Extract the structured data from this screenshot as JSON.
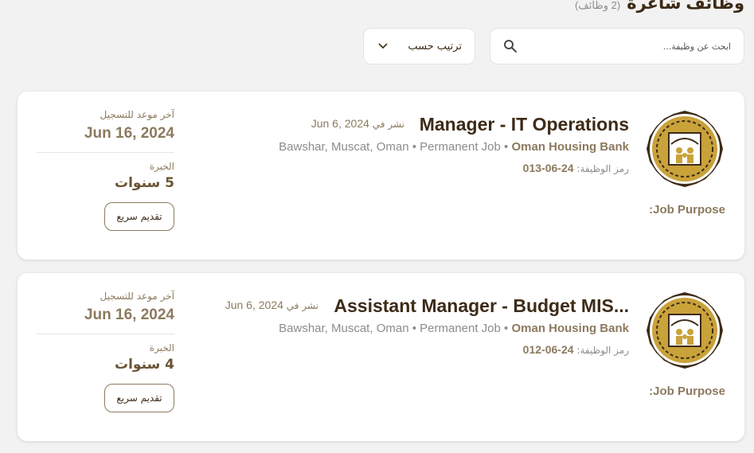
{
  "header": {
    "title": "وظائف شاغرة",
    "count_number": "2",
    "count_text": "(2 وظائف)"
  },
  "search": {
    "placeholder": "ابحث عن وظيفة...",
    "icon": "search-icon"
  },
  "sort": {
    "label": "ترتيب حسب",
    "icon": "chevron-down-icon"
  },
  "jobs": [
    {
      "title": "Manager - IT Operations",
      "posted_label": "نشر في",
      "posted_date": "Jun 6, 2024",
      "location": "Bawshar, Muscat, Oman",
      "job_type": "Permanent Job",
      "company": "Oman Housing Bank",
      "code_label": "رمز الوظيفة:",
      "code": "24-06-013",
      "purpose": ":Job Purpose",
      "deadline_label": "آخر موعد للتسجيل",
      "deadline": "Jun 16, 2024",
      "experience_label": "الخبرة",
      "experience": "5 سنوات",
      "apply_label": "تقديم سريع"
    },
    {
      "title": "Assistant Manager - Budget MIS...",
      "posted_label": "نشر في",
      "posted_date": "Jun 6, 2024",
      "location": "Bawshar, Muscat, Oman",
      "job_type": "Permanent Job",
      "company": "Oman Housing Bank",
      "code_label": "رمز الوظيفة:",
      "code": "24-06-012",
      "purpose": ":Job Purpose",
      "deadline_label": "آخر موعد للتسجيل",
      "deadline": "Jun 16, 2024",
      "experience_label": "الخبرة",
      "experience": "4 سنوات",
      "apply_label": "تقديم سريع"
    }
  ],
  "colors": {
    "brand_brown": "#3d2b17",
    "accent_gold": "#c9a23a",
    "muted": "#8c7a5e",
    "background": "#f2f2f2"
  }
}
